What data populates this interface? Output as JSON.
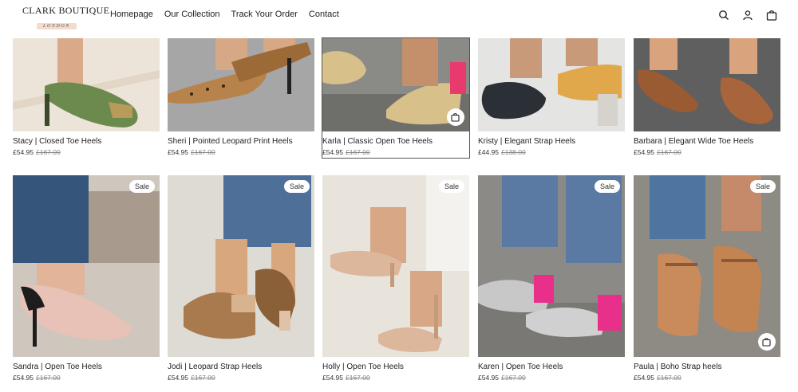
{
  "brand": {
    "name": "CLARK BOUTIQUE",
    "sub": "LONDON"
  },
  "nav": [
    "Homepage",
    "Our Collection",
    "Track Your Order",
    "Contact"
  ],
  "header_icons": [
    "search-icon",
    "account-icon",
    "cart-icon"
  ],
  "row1": [
    {
      "title": "Stacy | Closed Toe Heels",
      "price": "£54.95",
      "old": "£167.00"
    },
    {
      "title": "Sheri | Pointed Leopard Print Heels",
      "price": "£54.95",
      "old": "£167.00"
    },
    {
      "title": "Karla | Classic Open Toe Heels",
      "price": "£54.95",
      "old": "£167.00"
    },
    {
      "title": "Kristy | Elegant Strap Heels",
      "price": "£44.95",
      "old": "£138.00"
    },
    {
      "title": "Barbara | Elegant Wide Toe Heels",
      "price": "£54.95",
      "old": "£167.00"
    }
  ],
  "row2": [
    {
      "title": "Sandra | Open Toe Heels",
      "price": "£54.95",
      "old": "£167.00",
      "badge": "Sale"
    },
    {
      "title": "Jodi | Leopard Strap Heels",
      "price": "£54.95",
      "old": "£167.00",
      "badge": "Sale"
    },
    {
      "title": "Holly | Open Toe Heels",
      "price": "£54.95",
      "old": "£167.00",
      "badge": "Sale"
    },
    {
      "title": "Karen | Open Toe Heels",
      "price": "£54.95",
      "old": "£167.00",
      "badge": "Sale"
    },
    {
      "title": "Paula | Boho Strap heels",
      "price": "£54.95",
      "old": "£167.00",
      "badge": "Sale"
    }
  ],
  "colors": {
    "stacy": "#6d8a4e",
    "sheri": "#b7834a",
    "karla": "#d8c08a",
    "kristy": "#2b2f36",
    "barbara": "#9a5a32",
    "sandra": "#e8c2b6",
    "jodi": "#a87a4e",
    "holly": "#dcb79c",
    "karen": "#e8308a",
    "paula": "#c98a5c"
  }
}
